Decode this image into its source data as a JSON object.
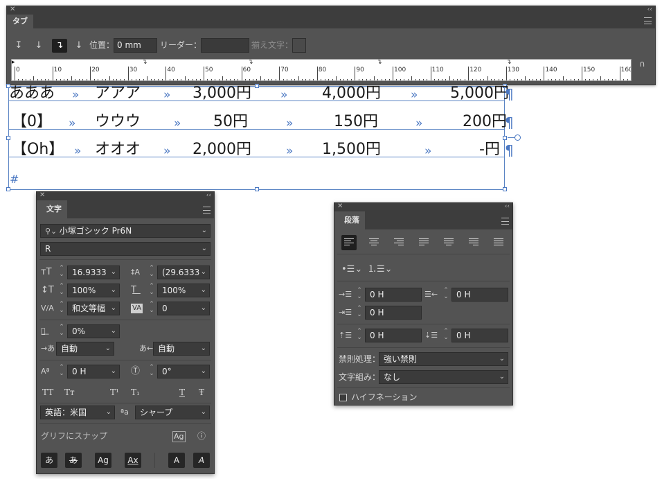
{
  "tabs_panel": {
    "title": "タブ",
    "position_label": "位置：",
    "position_value": "0 mm",
    "leader_label": "リーダー：",
    "leader_value": "",
    "align_on_label": "揃え文字：",
    "ruler_numbers": [
      "0",
      "10",
      "20",
      "30",
      "40",
      "50",
      "60",
      "70",
      "80",
      "90",
      "100",
      "110",
      "120",
      "130",
      "140",
      "150",
      "160"
    ]
  },
  "table_rows": [
    {
      "c1": "あああ",
      "c2": "アアア",
      "c3": "3,000円",
      "c4": "4,000円",
      "c5": "5,000円"
    },
    {
      "c1": "【0】",
      "c2": "ウウウ",
      "c3": "50円",
      "c4": "150円",
      "c5": "200円"
    },
    {
      "c1": "【Oh】",
      "c2": "オオオ",
      "c3": "2,000円",
      "c4": "1,500円",
      "c5": "-円"
    }
  ],
  "glyphs": {
    "tab_arrow": "»",
    "pilcrow": "¶",
    "end_mark": "#"
  },
  "character_panel": {
    "title": "文字",
    "font_family": "小塚ゴシック Pr6N",
    "font_style": "R",
    "font_size": "16.9333",
    "leading": "(29.6333",
    "vertical_scale": "100%",
    "horizontal_scale": "100%",
    "kerning": "和文等幅",
    "tracking": "0",
    "tsume": "0%",
    "aki_left": "自動",
    "aki_right": "自動",
    "baseline_shift": "0 H",
    "rotation": "0°",
    "style_buttons": [
      "TT",
      "Tт",
      "T¹",
      "T₁",
      "T",
      "Ŧ"
    ],
    "language": "英語：米国",
    "antialias_icon": "ªa",
    "antialias": "シャープ",
    "snap_label": "グリフにスナップ",
    "snap_buttons": [
      "あ",
      "あ",
      "Ag",
      "Ax",
      "A",
      "A"
    ]
  },
  "paragraph_panel": {
    "title": "段落",
    "left_indent": "0 H",
    "right_indent": "0 H",
    "first_line_indent": "0 H",
    "space_before": "0 H",
    "space_after": "0 H",
    "kinsoku_label": "禁則処理：",
    "kinsoku_value": "強い禁則",
    "mojikumi_label": "文字組み：",
    "mojikumi_value": "なし",
    "hyphenation_label": "ハイフネーション"
  }
}
